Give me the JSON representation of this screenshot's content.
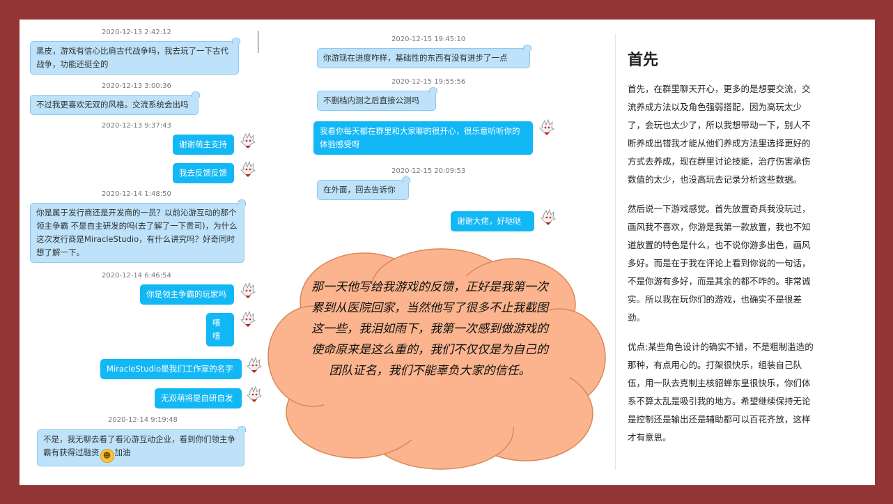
{
  "chat": {
    "ts1": "2020-12-13 2:42:12",
    "msg1": "黑皮，游戏有信心比肩古代战争吗，我去玩了一下古代战争，功能还挺全的",
    "ts2": "2020-12-13 3:00:36",
    "msg2": "不过我更喜欢无双的风格。交流系统会出吗",
    "ts3": "2020-12-13 9:37:43",
    "msg3": "谢谢萌主支持",
    "msg4": "我去反馈反馈",
    "ts4": "2020-12-14 1:48:50",
    "msg5": "你是属于发行商还是开发商的一员？以前沁游互动的那个 领主争霸 不是自主研发的吗(去了解了一下贵司)，为什么这次发行商是MiracleStudio，有什么讲究吗？好奇同时想了解一下。",
    "ts5": "2020-12-14 6:46:54",
    "msg6": "你是领主争霸的玩家吗",
    "msg7": "嘻嘻",
    "msg8": "MiracleStudio是我们工作室的名字",
    "msg9": "无双萌将是自研自发",
    "ts6": "2020-12-14 9:19:48",
    "msg10a": "不是，我无聊去看了看沁游互动企业，看到你们领主争霸有获得过融资",
    "msg10b": "加油",
    "ts7": "2020-12-15 19:45:10",
    "msg11": "你游现在进度咋样，基础性的东西有没有进步了一点",
    "ts8": "2020-12-15 19:55:56",
    "msg12": "不删档内测之后直接公测吗",
    "msg13": "我看你每天都在群里和大家聊的很开心，很乐意听听你的体验感受呀",
    "ts9": "2020-12-15 20:09:53",
    "msg14": "在外面，回去告诉你",
    "msg15": "谢谢大佬，好哒哒"
  },
  "cloud": {
    "text": "那一天他写给我游戏的反馈，正好是我第一次累到从医院回家，当然他写了很多不止我截图这一些，我泪如雨下，我第一次感到做游戏的使命原来是这么重的，我们不仅仅是为自己的团队证名，我们不能辜负大家的信任。"
  },
  "article": {
    "title": "首先",
    "p1": "首先，在群里聊天开心，更多的是想要交流，交流养成方法以及角色强弱搭配，因为高玩太少了，会玩也太少了，所以我想带动一下，别人不断养成出错我才能从他们养成方法里选择更好的方式去养成，现在群里讨论技能，治疗伤害承伤数值的太少，也没高玩去记录分析这些数据。",
    "p2": "然后说一下游戏感觉。首先放置奇兵我没玩过，画风我不喜欢，你游是我第一款放置，我也不知道放置的特色是什么，也不说你游多出色，画风多好。而是在于我在评论上看到你说的一句话，不是你游有多好，而是其余的都不咋的。非常诚实。所以我在玩你们的游戏，也确实不是很差劲。",
    "p3": "优点:某些角色设计的确实不错，不是粗制滥造的那种，有点用心的。打架很快乐，组装自己队伍，用一队去克制主核貂蝉东皇很快乐，你们体系不算太乱是吸引我的地方。希望继续保持无论是控制还是输出还是辅助都可以百花齐放，这样才有意思。"
  },
  "colors": {
    "frame": "#943535",
    "incoming_bubble": "#bde2f9",
    "outgoing_bubble": "#12b7f5",
    "cloud_fill": "#fbb48d"
  }
}
